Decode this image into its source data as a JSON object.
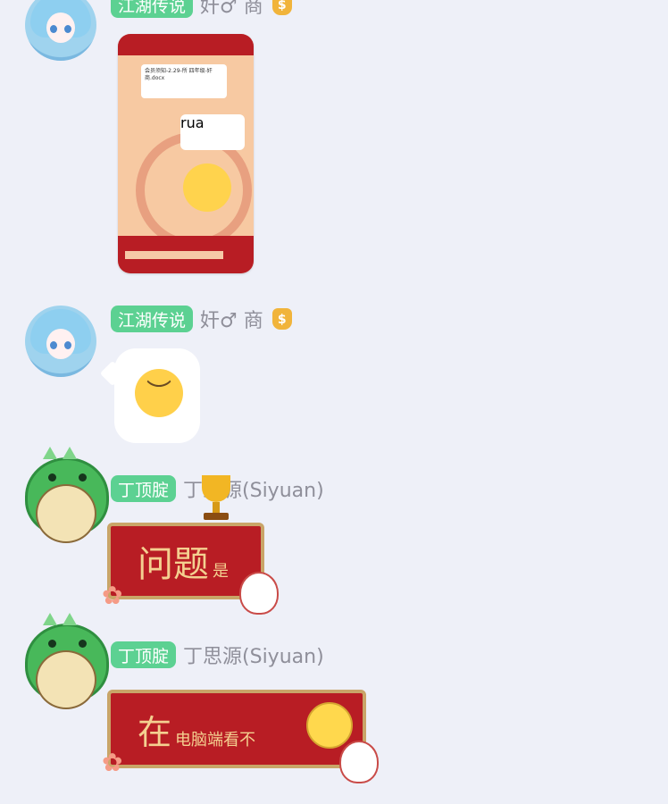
{
  "messages": [
    {
      "badge": "江湖传说",
      "nickname": "奸♂ 商",
      "badge_color": "#5cd192",
      "content_type": "screenshot-sticker"
    },
    {
      "badge": "江湖传说",
      "nickname": "奸♂ 商",
      "badge_color": "#5cd192",
      "content_type": "emoji"
    },
    {
      "badge": "丁顶腚",
      "nickname": "丁思源(Siyuan)",
      "badge_color": "#5cd192",
      "banner_text": "问题",
      "banner_small": "是"
    },
    {
      "badge": "丁顶腚",
      "nickname": "丁思源(Siyuan)",
      "badge_color": "#5cd192",
      "banner_text": "在",
      "banner_small": "电脑端看不"
    }
  ],
  "sticker": {
    "file_name": "会员须知-2.29-所\n四年级-奸商.docx",
    "sticker_text": "rua"
  },
  "icons": {
    "coin": "moneybag-icon",
    "sad": "sad-face-icon",
    "trophy": "trophy-icon",
    "laugh": "grinning-face-icon",
    "cat": "cat-sticker-icon",
    "flower": "flower-icon"
  },
  "colors": {
    "background": "#eef0f8",
    "banner_red": "#b81d24",
    "banner_gold": "#c9a568",
    "name_gray": "#8f8f9a"
  }
}
